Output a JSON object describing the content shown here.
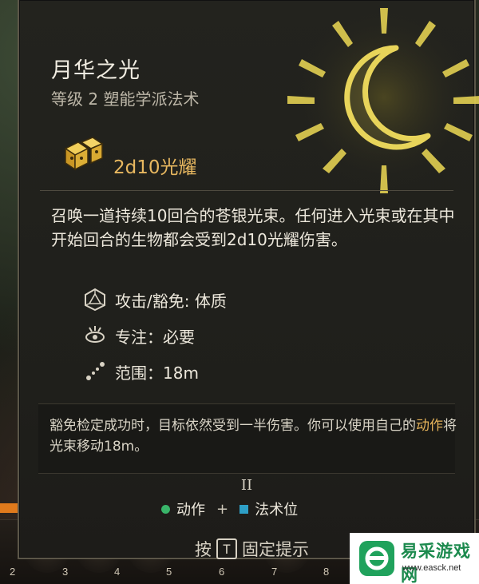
{
  "spell": {
    "name": "月华之光",
    "subtitle": "等级 2 塑能学派法术",
    "damage": "2d10光耀",
    "description": "召唤一道持续10回合的苍银光束。任何进入光束或在其中开始回合的生物都会受到2d10光耀伤害。",
    "properties": [
      {
        "icon": "d20-icon",
        "text": "攻击/豁免: 体质"
      },
      {
        "icon": "concentration-icon",
        "text": "专注：必要"
      },
      {
        "icon": "range-icon",
        "text": "范围：18m"
      }
    ],
    "note": {
      "part1": "豁免检定成功时，目标依然受到一半伤害。你可以使用自己的",
      "highlight": "动作",
      "part2": "将光束移动18m。"
    },
    "page_indicator": "II",
    "costs": {
      "action_label": "动作",
      "plus": "+",
      "slot_label": "法术位"
    },
    "pin_hint": {
      "prefix": "按",
      "key": "T",
      "suffix": "固定提示"
    }
  },
  "hotbar": {
    "numbers": [
      "2",
      "3",
      "4",
      "5",
      "6",
      "7",
      "8"
    ]
  },
  "watermark": {
    "name": "易采游戏网",
    "url": "www.easck.net"
  },
  "colors": {
    "damage": "#e8b860",
    "highlight": "#e4b25a",
    "action": "#39b56a",
    "spell_slot": "#2e9fc6",
    "spell_icon": "#e2cf52"
  }
}
